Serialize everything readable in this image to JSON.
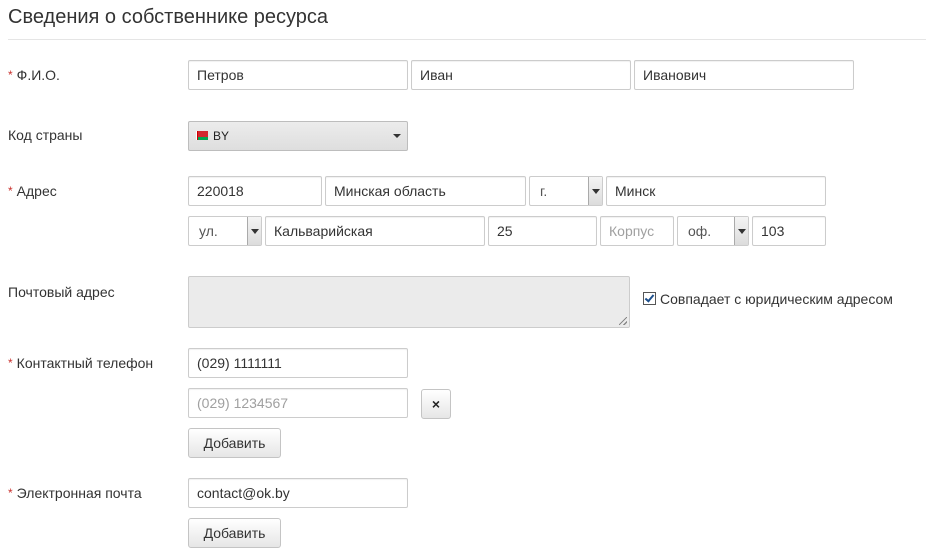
{
  "section": {
    "title": "Сведения о собственнике ресурса"
  },
  "fio": {
    "label": "Ф.И.О.",
    "required_mark": "*",
    "last_name": "Петров",
    "first_name": "Иван",
    "middle_name": "Иванович"
  },
  "country": {
    "label": "Код страны",
    "value": "BY",
    "flag_icon": "belarus-flag-icon"
  },
  "address": {
    "label": "Адрес",
    "required_mark": "*",
    "postal_code": "220018",
    "region": "Минская область",
    "locality_type": "г.",
    "city": "Минск",
    "street_type": "ул.",
    "street": "Кальварийская",
    "house": "25",
    "building_placeholder": "Корпус",
    "office_type": "оф.",
    "office": "103"
  },
  "postal_address": {
    "label": "Почтовый адрес",
    "value": "",
    "same_as_legal_label": "Совпадает с юридическим адресом",
    "same_as_legal_checked": true
  },
  "phone": {
    "label": "Контактный телефон",
    "required_mark": "*",
    "values": [
      "(029) 1111111"
    ],
    "extra_placeholder": "(029) 1234567",
    "remove_icon": "close-icon",
    "remove_label": "×",
    "add_label": "Добавить"
  },
  "email": {
    "label": "Электронная почта",
    "required_mark": "*",
    "value": "contact@ok.by",
    "add_label": "Добавить"
  }
}
